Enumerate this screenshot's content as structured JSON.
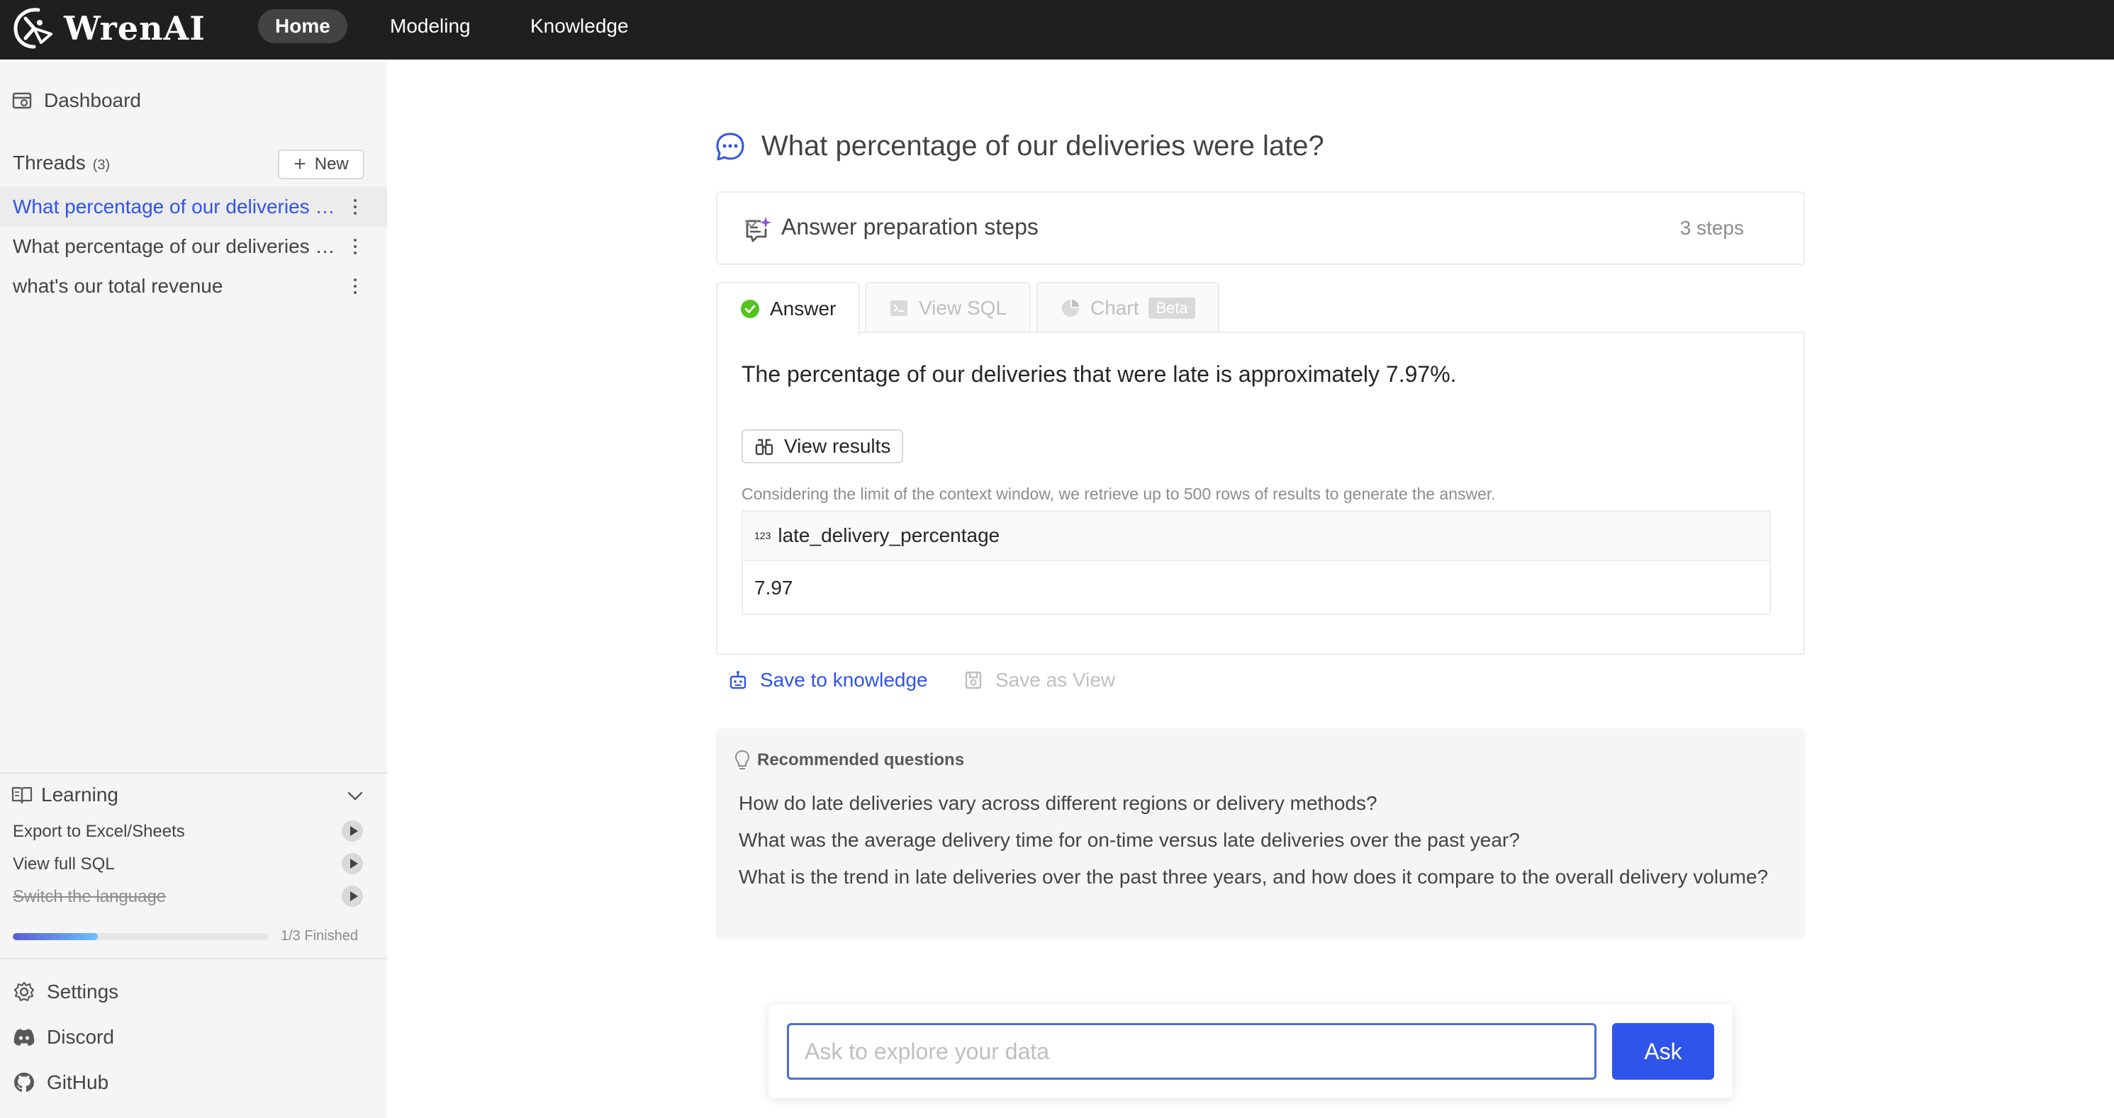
{
  "app": {
    "name": "WrenAI"
  },
  "nav": {
    "items": [
      {
        "label": "Home"
      },
      {
        "label": "Modeling"
      },
      {
        "label": "Knowledge"
      }
    ],
    "active": "Home"
  },
  "sidebar": {
    "dashboard_label": "Dashboard",
    "threads_label": "Threads",
    "threads_count": "(3)",
    "new_label": "New",
    "threads": [
      {
        "label": "What percentage of our deliveries were late?"
      },
      {
        "label": "What percentage of our deliveries were late?"
      },
      {
        "label": "what's our total revenue"
      }
    ],
    "learning": {
      "label": "Learning",
      "items": [
        {
          "label": "Export to Excel/Sheets",
          "done": false
        },
        {
          "label": "View full SQL",
          "done": false
        },
        {
          "label": "Switch the language",
          "done": true
        }
      ],
      "progress_fraction": 0.333,
      "progress_text": "1/3 Finished"
    },
    "bottom": {
      "settings_label": "Settings",
      "discord_label": "Discord",
      "github_label": "GitHub"
    }
  },
  "main": {
    "question": "What percentage of our deliveries were late?",
    "prep": {
      "title": "Answer preparation steps",
      "steps": "3 steps"
    },
    "tabs": [
      {
        "label": "Answer"
      },
      {
        "label": "View SQL"
      },
      {
        "label": "Chart",
        "badge": "Beta"
      }
    ],
    "answer": {
      "text": "The percentage of our deliveries that were late is approximately 7.97%.",
      "view_results_label": "View results",
      "context_note": "Considering the limit of the context window, we retrieve up to 500 rows of results to generate the answer.",
      "table": {
        "type_badge": "123",
        "column": "late_delivery_percentage",
        "rows": [
          "7.97"
        ]
      }
    },
    "actions": {
      "save_knowledge": "Save to knowledge",
      "save_view": "Save as View"
    },
    "recommended": {
      "title": "Recommended questions",
      "questions": [
        "How do late deliveries vary across different regions or delivery methods?",
        "What was the average delivery time for on-time versus late deliveries over the past year?",
        "What is the trend in late deliveries over the past three years, and how does it compare to the overall delivery volume?"
      ]
    },
    "ask": {
      "placeholder": "Ask to explore your data",
      "button_label": "Ask"
    }
  },
  "colors": {
    "accent": "#2f54eb",
    "topbar": "#1f1f1f",
    "success": "#52c41a",
    "sidebar_bg": "#f5f5f5"
  }
}
